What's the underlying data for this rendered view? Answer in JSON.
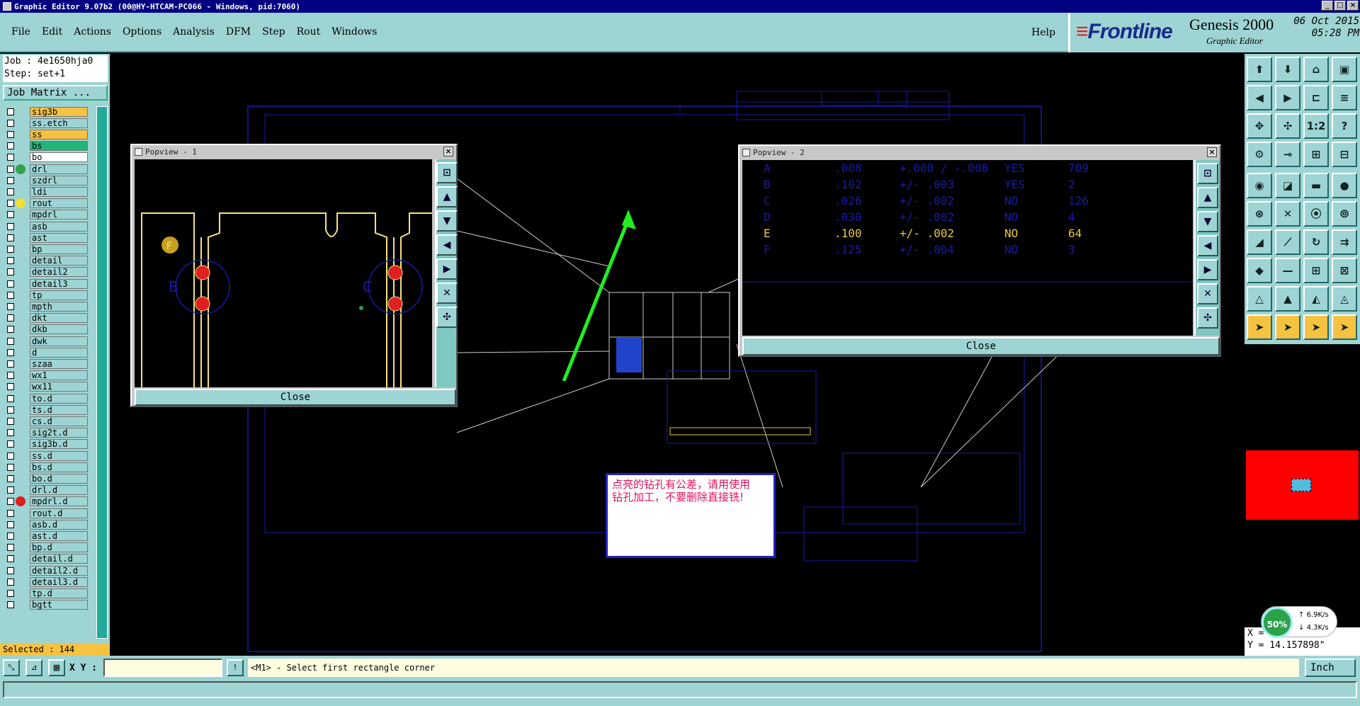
{
  "window": {
    "title": "Graphic Editor 9.07b2  (00@HY-HTCAM-PC066 - Windows, pid:7060)"
  },
  "menu": {
    "items": [
      "File",
      "Edit",
      "Actions",
      "Options",
      "Analysis",
      "DFM",
      "Step",
      "Rout",
      "Windows"
    ],
    "help": "Help"
  },
  "brand": {
    "logo": "Frontline",
    "product": "Genesis 2000",
    "subtitle": "Graphic Editor",
    "date": "06 Oct 2015",
    "time": "05:28 PM"
  },
  "job": {
    "job_line": "Job : 4e1650hja0",
    "step_line": "Step: set+1",
    "matrix_button": "Job Matrix ..."
  },
  "layers": [
    {
      "name": "sig3b",
      "color": "#f5c242",
      "dot": ""
    },
    {
      "name": "ss.etch",
      "color": "#9ed4d4",
      "dot": ""
    },
    {
      "name": "ss",
      "color": "#f5c242",
      "dot": ""
    },
    {
      "name": "bs",
      "color": "#22b57a",
      "dot": ""
    },
    {
      "name": "bo",
      "color": "#ffffff",
      "dot": ""
    },
    {
      "name": "drl",
      "color": "#9ed4d4",
      "dot": "#2ca24a"
    },
    {
      "name": "szdrl",
      "color": "#9ed4d4",
      "dot": ""
    },
    {
      "name": "ldi",
      "color": "#9ed4d4",
      "dot": ""
    },
    {
      "name": "rout",
      "color": "#9ed4d4",
      "dot": "#f0e030"
    },
    {
      "name": "mpdrl",
      "color": "#9ed4d4",
      "dot": ""
    },
    {
      "name": "asb",
      "color": "#9ed4d4",
      "dot": ""
    },
    {
      "name": "ast",
      "color": "#9ed4d4",
      "dot": ""
    },
    {
      "name": "bp",
      "color": "#9ed4d4",
      "dot": ""
    },
    {
      "name": "detail",
      "color": "#9ed4d4",
      "dot": ""
    },
    {
      "name": "detail2",
      "color": "#9ed4d4",
      "dot": ""
    },
    {
      "name": "detail3",
      "color": "#9ed4d4",
      "dot": ""
    },
    {
      "name": "tp",
      "color": "#9ed4d4",
      "dot": ""
    },
    {
      "name": "mpth",
      "color": "#9ed4d4",
      "dot": ""
    },
    {
      "name": "dkt",
      "color": "#9ed4d4",
      "dot": ""
    },
    {
      "name": "dkb",
      "color": "#9ed4d4",
      "dot": ""
    },
    {
      "name": "dwk",
      "color": "#9ed4d4",
      "dot": ""
    },
    {
      "name": "d",
      "color": "#9ed4d4",
      "dot": ""
    },
    {
      "name": "szaa",
      "color": "#9ed4d4",
      "dot": ""
    },
    {
      "name": "wx1",
      "color": "#9ed4d4",
      "dot": ""
    },
    {
      "name": "wx11",
      "color": "#9ed4d4",
      "dot": ""
    },
    {
      "name": "to.d",
      "color": "#9ed4d4",
      "dot": ""
    },
    {
      "name": "ts.d",
      "color": "#9ed4d4",
      "dot": ""
    },
    {
      "name": "cs.d",
      "color": "#9ed4d4",
      "dot": ""
    },
    {
      "name": "sig2t.d",
      "color": "#9ed4d4",
      "dot": ""
    },
    {
      "name": "sig3b.d",
      "color": "#9ed4d4",
      "dot": ""
    },
    {
      "name": "ss.d",
      "color": "#9ed4d4",
      "dot": ""
    },
    {
      "name": "bs.d",
      "color": "#9ed4d4",
      "dot": ""
    },
    {
      "name": "bo.d",
      "color": "#9ed4d4",
      "dot": ""
    },
    {
      "name": "drl.d",
      "color": "#9ed4d4",
      "dot": ""
    },
    {
      "name": "mpdrl.d",
      "color": "#9ed4d4",
      "dot": "#e02020"
    },
    {
      "name": "rout.d",
      "color": "#9ed4d4",
      "dot": ""
    },
    {
      "name": "asb.d",
      "color": "#9ed4d4",
      "dot": ""
    },
    {
      "name": "ast.d",
      "color": "#9ed4d4",
      "dot": ""
    },
    {
      "name": "bp.d",
      "color": "#9ed4d4",
      "dot": ""
    },
    {
      "name": "detail.d",
      "color": "#9ed4d4",
      "dot": ""
    },
    {
      "name": "detail2.d",
      "color": "#9ed4d4",
      "dot": ""
    },
    {
      "name": "detail3.d",
      "color": "#9ed4d4",
      "dot": ""
    },
    {
      "name": "tp.d",
      "color": "#9ed4d4",
      "dot": ""
    },
    {
      "name": "bgtt",
      "color": "#9ed4d4",
      "dot": ""
    }
  ],
  "selected": "Selected : 144",
  "popview1": {
    "title": "Popview - 1",
    "close": "Close",
    "labels": [
      "F",
      "B",
      "C"
    ]
  },
  "popview2": {
    "title": "Popview - 2",
    "close": "Close",
    "rows": [
      [
        "A",
        ".008",
        "+.000 / -.008",
        "YES",
        "709"
      ],
      [
        "B",
        ".102",
        "+/- .003",
        "YES",
        "2"
      ],
      [
        "C",
        ".026",
        "+/- .002",
        "NO",
        "126"
      ],
      [
        "D",
        ".030",
        "+/- .002",
        "NO",
        "4"
      ],
      [
        "E",
        ".100",
        "+/- .002",
        "NO",
        "64"
      ],
      [
        "F",
        ".125",
        "+/- .004",
        "NO",
        "3"
      ]
    ]
  },
  "annotation": {
    "line1": "点亮的钻孔有公差，请用使用",
    "line2": "钻孔加工，不要删除直接铣!"
  },
  "coords": {
    "x": "X = 7.859440\"",
    "y": "Y = 14.157898\""
  },
  "network": {
    "percent": "50%",
    "up": "6.9K/s",
    "down": "4.3K/s"
  },
  "status": {
    "xy_label": "X Y :",
    "xy_value": "",
    "message": "<M1> - Select first rectangle corner",
    "unit": "Inch"
  }
}
